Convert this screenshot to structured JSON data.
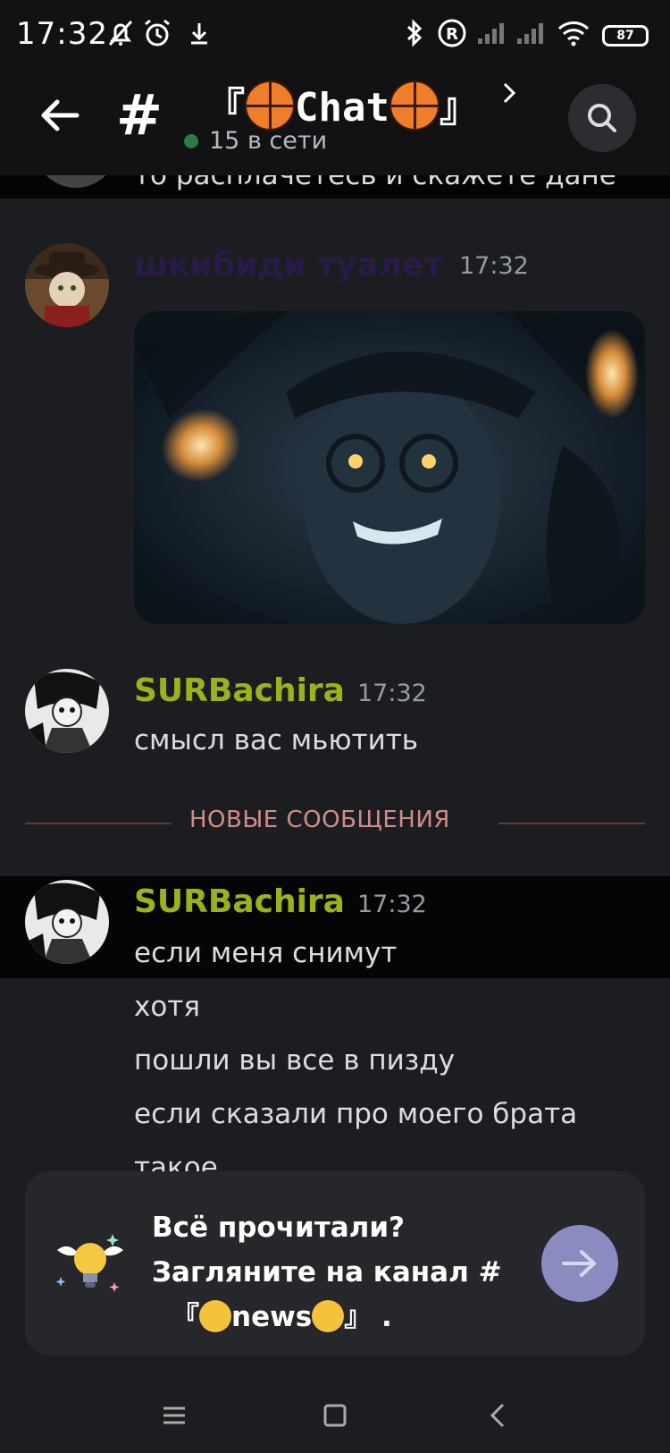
{
  "status_bar": {
    "time": "17:32",
    "icons": [
      "bell-off-icon",
      "alarm-icon",
      "download-icon",
      "bluetooth-icon",
      "registered-icon",
      "signal-icon",
      "signal-icon",
      "wifi-icon"
    ],
    "battery": "87"
  },
  "header": {
    "title_left": "『",
    "title_text": "Chat",
    "title_right": "』",
    "online_text": "15 в сети"
  },
  "messages": {
    "cut_text": "то расплачетесь и скажете дане",
    "msg1": {
      "username": "шкибиди туалет",
      "time": "17:32",
      "username_color": "#2a1a47"
    },
    "msg2": {
      "username": "SURBachira",
      "time": "17:32",
      "text": "смысл вас мьютить",
      "username_color": "#9ab31a"
    },
    "divider": "НОВЫЕ СООБЩЕНИЯ",
    "msg3": {
      "username": "SURBachira",
      "time": "17:32",
      "lines": [
        "если меня снимут",
        "хотя",
        "пошли вы все в пизду",
        "если сказали про моего брата",
        "такое"
      ]
    }
  },
  "jump_card": {
    "line1": "Всё прочитали?",
    "line2": "Загляните на канал #",
    "line3_left": "『",
    "line3_text": "news",
    "line3_right": "』 ."
  },
  "nav": [
    "menu-icon",
    "home-square-icon",
    "back-triangle-icon"
  ]
}
